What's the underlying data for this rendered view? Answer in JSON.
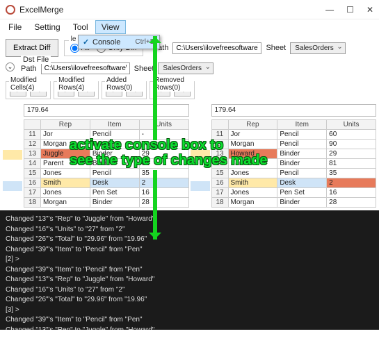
{
  "window": {
    "title": "ExcelMerge",
    "min": "—",
    "max": "☐",
    "close": "✕"
  },
  "menu": {
    "items": [
      "File",
      "Setting",
      "Tool",
      "View"
    ],
    "activeIndex": 3,
    "dropdown": {
      "checked": true,
      "label": "Console",
      "shortcut": "Ctrl+D"
    }
  },
  "toolbar": {
    "extract": "Extract Diff",
    "srcLegend": "le",
    "radioAll": "All",
    "radioDiff": "Only Diff",
    "pathLabel": "Path",
    "pathValue": "C:\\Users\\ilovefreesoftware\\",
    "sheetLabel": "Sheet",
    "sheetValue": "SalesOrders"
  },
  "dst": {
    "legend": "Dst File",
    "pathLabel": "Path",
    "pathValue": "C:\\Users\\ilovefreesoftware\\",
    "sheetLabel": "Sheet",
    "sheetValue": "SalesOrders"
  },
  "nav": {
    "g1": "Modified Cells(4)",
    "g2": "Modified Rows(4)",
    "g3": "Added Rows(0)",
    "g4": "Removed Rows(0)",
    "left": "←",
    "right": "→"
  },
  "formulaLeft": "179.64",
  "formulaRight": "179.64",
  "headers": [
    "Rep",
    "Item",
    "Units"
  ],
  "leftRows": [
    {
      "n": "11",
      "c": [
        "Jor",
        "Pencil",
        "-"
      ],
      "cls": [
        "",
        "",
        ""
      ]
    },
    {
      "n": "12",
      "c": [
        "Morgan",
        "Pencil",
        "90"
      ],
      "cls": [
        "",
        "",
        ""
      ]
    },
    {
      "n": "13",
      "c": [
        "Juggle",
        "Binder",
        "29"
      ],
      "cls": [
        "hl-red",
        "",
        ""
      ]
    },
    {
      "n": "14",
      "c": [
        "Parent",
        "Binder",
        "81"
      ],
      "cls": [
        "",
        "",
        ""
      ]
    },
    {
      "n": "15",
      "c": [
        "Jones",
        "Pencil",
        "35"
      ],
      "cls": [
        "",
        "",
        ""
      ]
    },
    {
      "n": "16",
      "c": [
        "Smith",
        "Desk",
        "2"
      ],
      "cls": [
        "hl-yel",
        "hl-blu",
        "hl-blu"
      ]
    },
    {
      "n": "17",
      "c": [
        "Jones",
        "Pen Set",
        "16"
      ],
      "cls": [
        "",
        "",
        ""
      ]
    },
    {
      "n": "18",
      "c": [
        "Morgan",
        "Binder",
        "28"
      ],
      "cls": [
        "",
        "",
        ""
      ]
    }
  ],
  "rightRows": [
    {
      "n": "11",
      "c": [
        "Jor",
        "Pencil",
        "60"
      ],
      "cls": [
        "",
        "",
        ""
      ]
    },
    {
      "n": "12",
      "c": [
        "Morgan",
        "Pencil",
        "90"
      ],
      "cls": [
        "",
        "",
        ""
      ]
    },
    {
      "n": "13",
      "c": [
        "Howard",
        "Binder",
        "29"
      ],
      "cls": [
        "hl-red",
        "",
        ""
      ]
    },
    {
      "n": "14",
      "c": [
        "Parent",
        "Binder",
        "81"
      ],
      "cls": [
        "",
        "",
        ""
      ]
    },
    {
      "n": "15",
      "c": [
        "Jones",
        "Pencil",
        "35"
      ],
      "cls": [
        "",
        "",
        ""
      ]
    },
    {
      "n": "16",
      "c": [
        "Smith",
        "Desk",
        "2"
      ],
      "cls": [
        "hl-yel",
        "hl-blu",
        "hl-red"
      ]
    },
    {
      "n": "17",
      "c": [
        "Jones",
        "Pen Set",
        "16"
      ],
      "cls": [
        "",
        "",
        ""
      ]
    },
    {
      "n": "18",
      "c": [
        "Morgan",
        "Binder",
        "28"
      ],
      "cls": [
        "",
        "",
        ""
      ]
    }
  ],
  "console": [
    "Changed \"13\"'s \"Rep\" to \"Juggle\" from \"Howard\"",
    "Changed \"16\"'s \"Units\" to \"27\" from \"2\"",
    "Changed \"26\"'s \"Total\" to \"29.96\" from \"19.96\"",
    "Changed \"39\"'s \"Item\" to \"Pencil\" from \"Pen\"",
    "",
    "[2] >",
    "Changed \"39\"'s \"Item\" to \"Pencil\" from \"Pen\"",
    "Changed \"13\"'s \"Rep\" to \"Juggle\" from \"Howard\"",
    "Changed \"16\"'s \"Units\" to \"27\" from \"2\"",
    "Changed \"26\"'s \"Total\" to \"29.96\" from \"19.96\"",
    "",
    "[3] >",
    "Changed \"39\"'s \"Item\" to \"Pencil\" from \"Pen\"",
    "Changed \"13\"'s \"Rep\" to \"Juggle\" from \"Howard\""
  ],
  "annot": {
    "l1": "activate console box to",
    "l2": "see the type of changes made"
  }
}
